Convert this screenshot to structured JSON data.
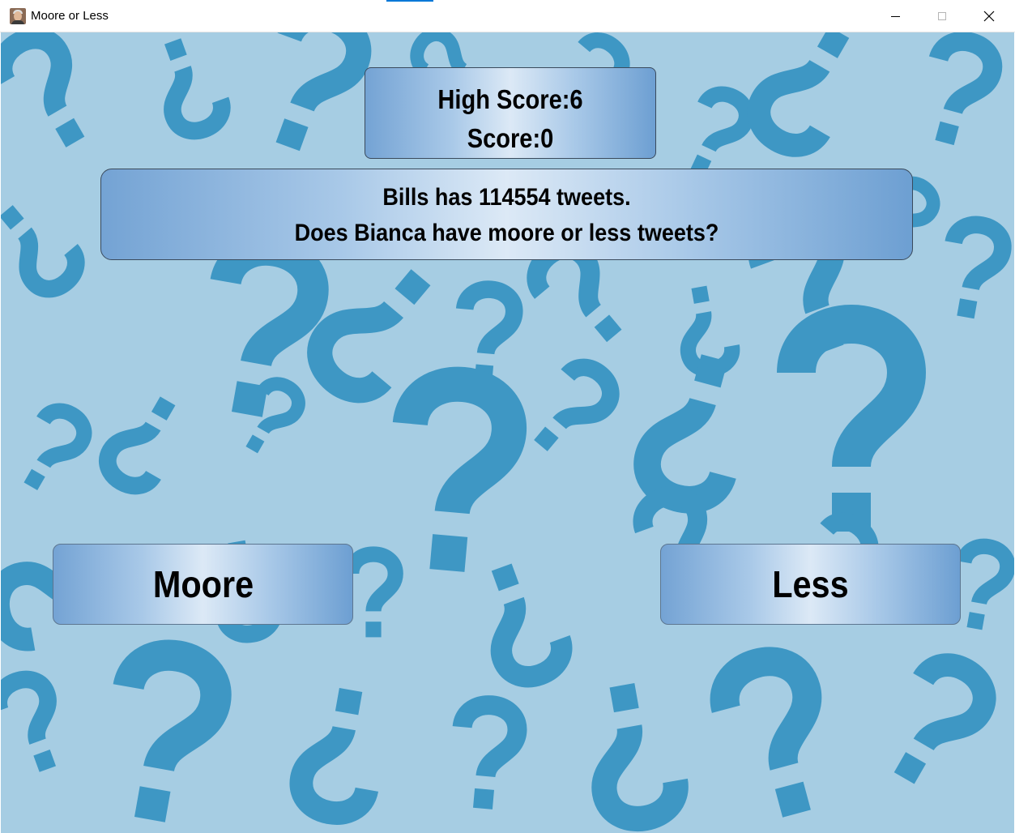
{
  "window": {
    "title": "Moore or Less",
    "controls": [
      "minimize",
      "maximize",
      "close"
    ]
  },
  "game": {
    "high_score_text": "High Score:6",
    "score_text": "Score:0",
    "question_line1": "Bills has 114554 tweets.",
    "question_line2": "Does Bianca have moore or less tweets?",
    "buttons": {
      "moore_label": "Moore",
      "less_label": "Less"
    },
    "background": {
      "pattern": "question-marks",
      "light_color": "#a6cde3",
      "dark_color": "#3e97c4"
    }
  }
}
